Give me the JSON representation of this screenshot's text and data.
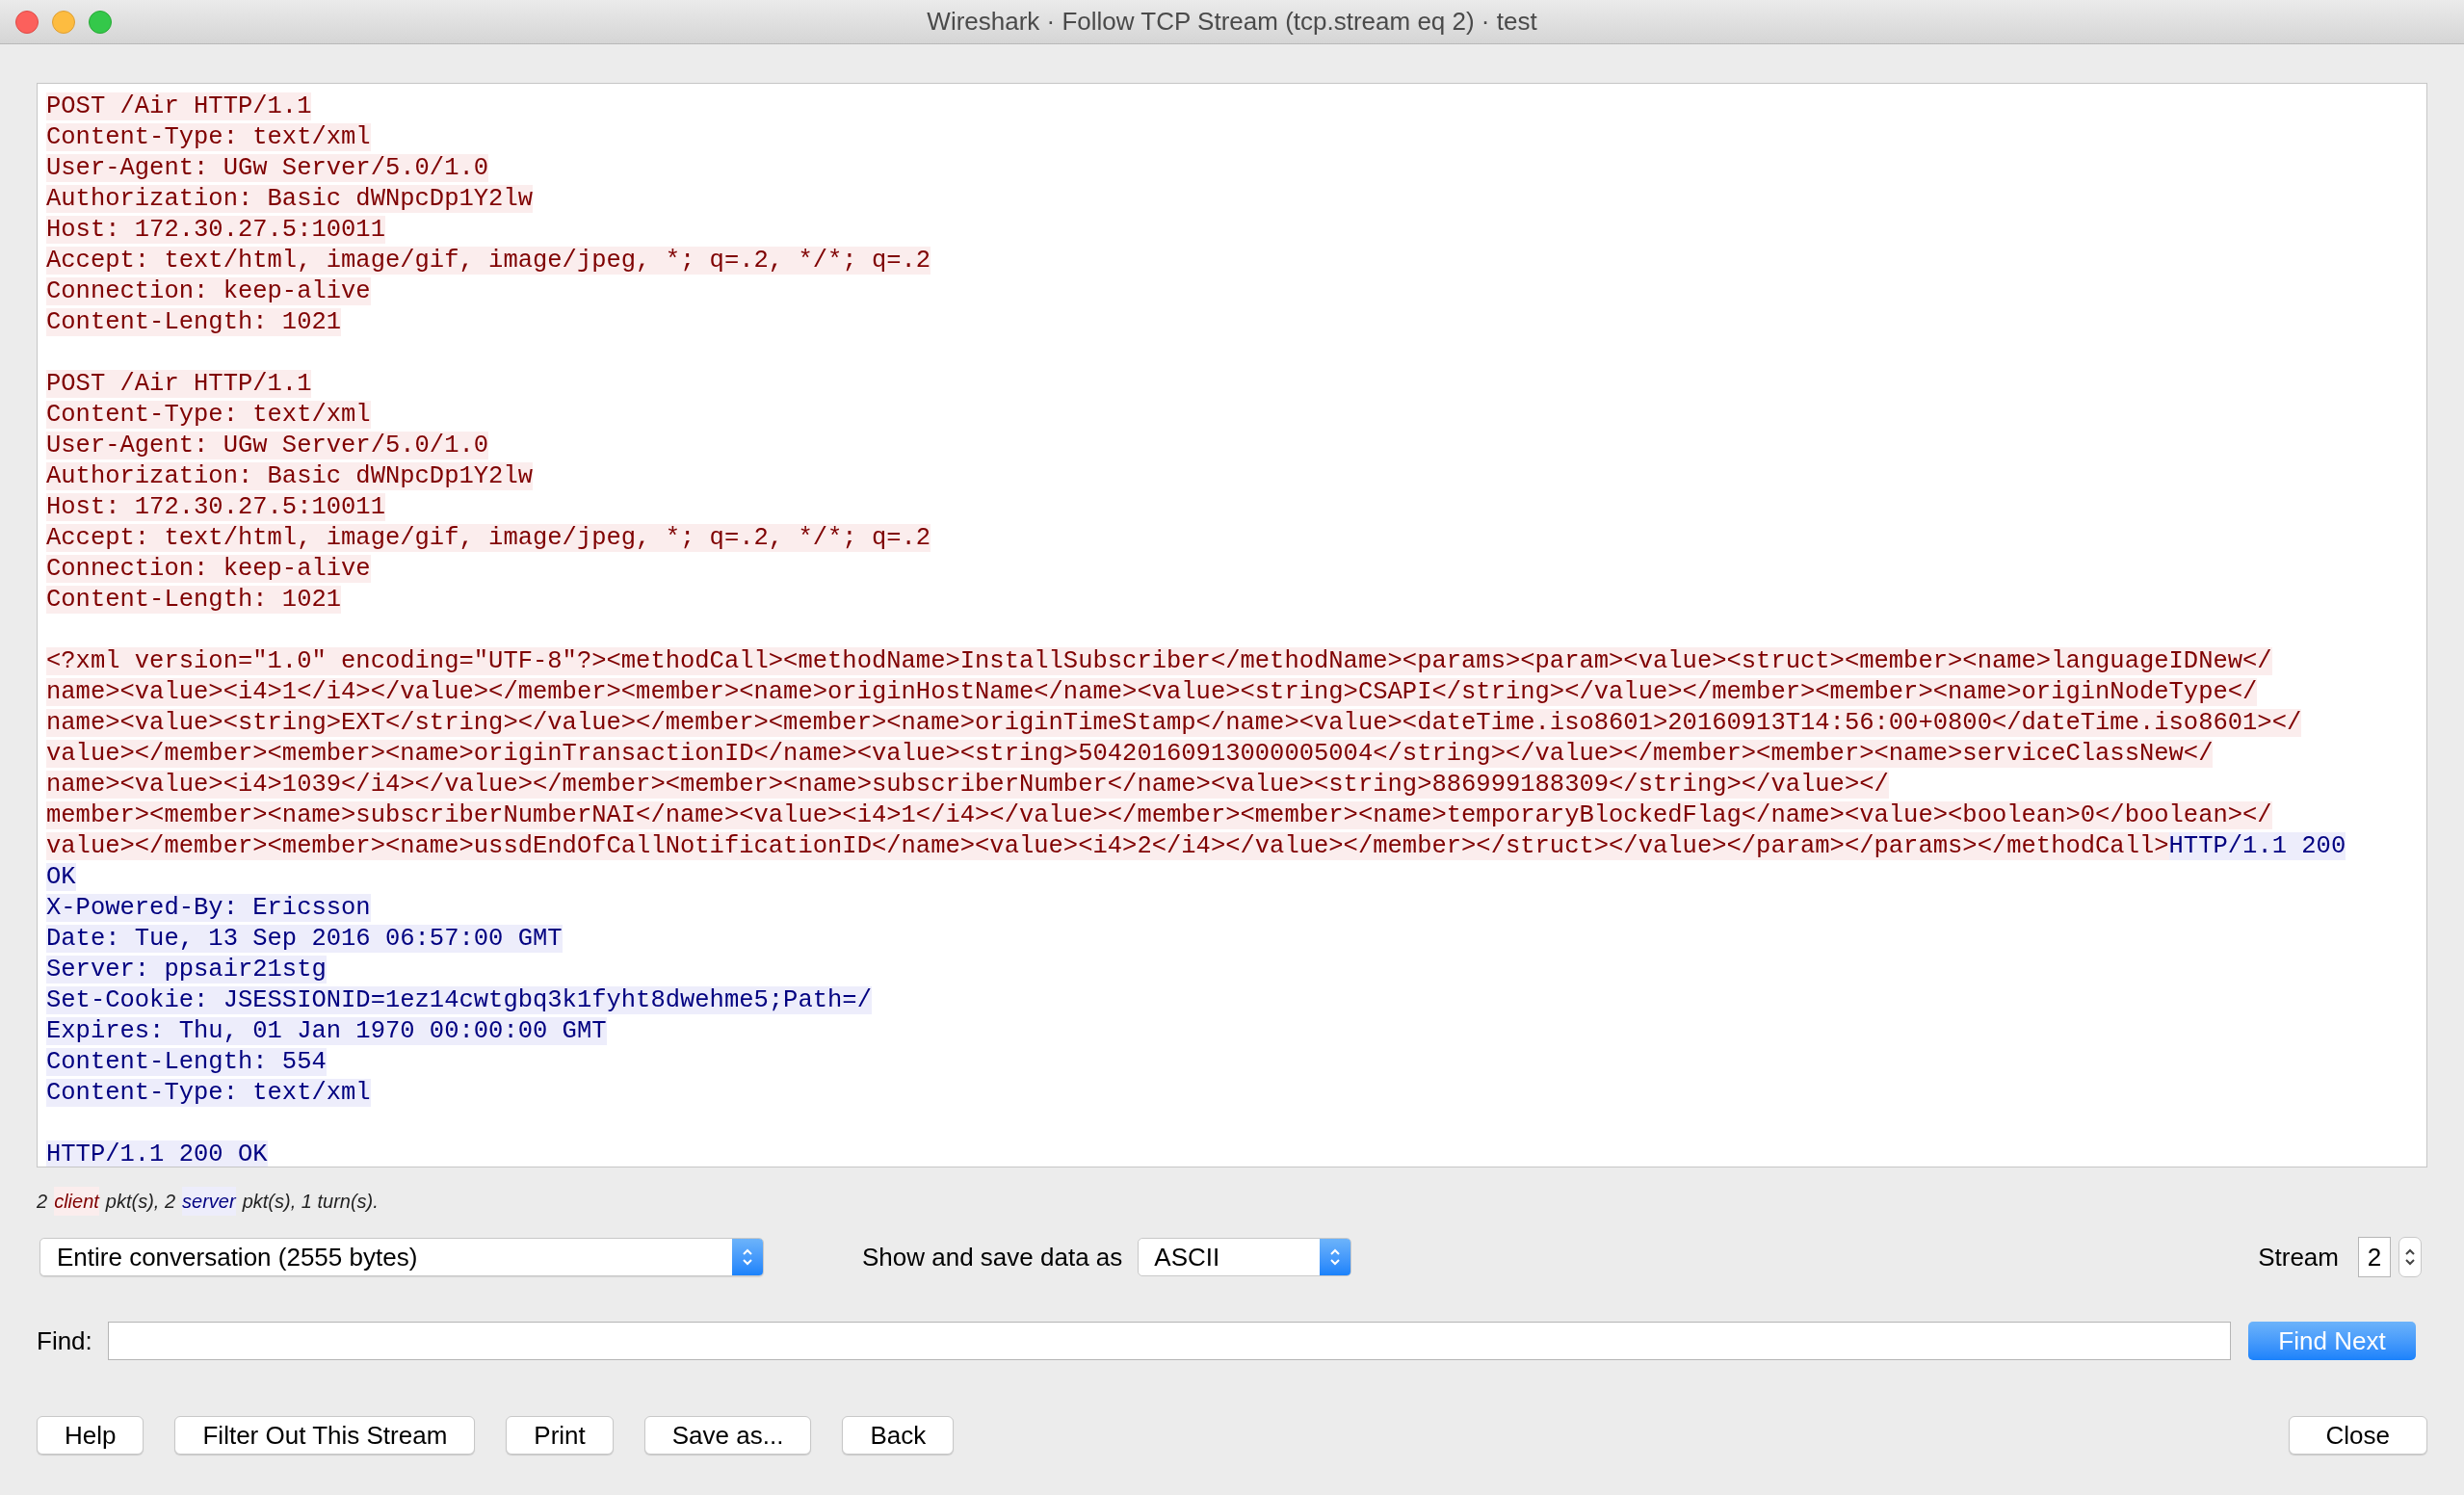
{
  "window": {
    "title": "Wireshark · Follow TCP Stream (tcp.stream eq 2) · test"
  },
  "stream": {
    "blocks": [
      {
        "lines": [
          [
            {
              "kind": "client",
              "text": "POST /Air HTTP/1.1"
            }
          ],
          [
            {
              "kind": "client",
              "text": "Content-Type: text/xml"
            }
          ],
          [
            {
              "kind": "client",
              "text": "User-Agent: UGw Server/5.0/1.0"
            }
          ],
          [
            {
              "kind": "client",
              "text": "Authorization: Basic dWNpcDp1Y2lw"
            }
          ],
          [
            {
              "kind": "client",
              "text": "Host: 172.30.27.5:10011"
            }
          ],
          [
            {
              "kind": "client",
              "text": "Accept: text/html, image/gif, image/jpeg, *; q=.2, */*; q=.2"
            }
          ],
          [
            {
              "kind": "client",
              "text": "Connection: keep-alive"
            }
          ],
          [
            {
              "kind": "client",
              "text": "Content-Length: 1021"
            }
          ]
        ]
      },
      {
        "lines": [
          [
            {
              "kind": "client",
              "text": "POST /Air HTTP/1.1"
            }
          ],
          [
            {
              "kind": "client",
              "text": "Content-Type: text/xml"
            }
          ],
          [
            {
              "kind": "client",
              "text": "User-Agent: UGw Server/5.0/1.0"
            }
          ],
          [
            {
              "kind": "client",
              "text": "Authorization: Basic dWNpcDp1Y2lw"
            }
          ],
          [
            {
              "kind": "client",
              "text": "Host: 172.30.27.5:10011"
            }
          ],
          [
            {
              "kind": "client",
              "text": "Accept: text/html, image/gif, image/jpeg, *; q=.2, */*; q=.2"
            }
          ],
          [
            {
              "kind": "client",
              "text": "Connection: keep-alive"
            }
          ],
          [
            {
              "kind": "client",
              "text": "Content-Length: 1021"
            }
          ]
        ]
      },
      {
        "lines": [
          [
            {
              "kind": "client",
              "text": "<?xml version=\"1.0\" encoding=\"UTF-8\"?><methodCall><methodName>InstallSubscriber</methodName><params><param><value><struct><member><name>languageIDNew</"
            }
          ],
          [
            {
              "kind": "client",
              "text": "name><value><i4>1</i4></value></member><member><name>originHostName</name><value><string>CSAPI</string></value></member><member><name>originNodeType</"
            }
          ],
          [
            {
              "kind": "client",
              "text": "name><value><string>EXT</string></value></member><member><name>originTimeStamp</name><value><dateTime.iso8601>20160913T14:56:00+0800</dateTime.iso8601></"
            }
          ],
          [
            {
              "kind": "client",
              "text": "value></member><member><name>originTransactionID</name><value><string>50420160913000005004</string></value></member><member><name>serviceClassNew</"
            }
          ],
          [
            {
              "kind": "client",
              "text": "name><value><i4>1039</i4></value></member><member><name>subscriberNumber</name><value><string>886999188309</string></value></"
            }
          ],
          [
            {
              "kind": "client",
              "text": "member><member><name>subscriberNumberNAI</name><value><i4>1</i4></value></member><member><name>temporaryBlockedFlag</name><value><boolean>0</boolean></"
            }
          ],
          [
            {
              "kind": "client",
              "text": "value></member><member><name>ussdEndOfCallNotificationID</name><value><i4>2</i4></value></member></struct></value></param></params></methodCall>"
            },
            {
              "kind": "server",
              "text": "HTTP/1.1 200"
            }
          ],
          [
            {
              "kind": "server",
              "text": "OK"
            }
          ],
          [
            {
              "kind": "server",
              "text": "X-Powered-By: Ericsson"
            }
          ],
          [
            {
              "kind": "server",
              "text": "Date: Tue, 13 Sep 2016 06:57:00 GMT"
            }
          ],
          [
            {
              "kind": "server",
              "text": "Server: ppsair21stg"
            }
          ],
          [
            {
              "kind": "server",
              "text": "Set-Cookie: JSESSIONID=1ez14cwtgbq3k1fyht8dwehme5;Path=/"
            }
          ],
          [
            {
              "kind": "server",
              "text": "Expires: Thu, 01 Jan 1970 00:00:00 GMT"
            }
          ],
          [
            {
              "kind": "server",
              "text": "Content-Length: 554"
            }
          ],
          [
            {
              "kind": "server",
              "text": "Content-Type: text/xml"
            }
          ]
        ]
      },
      {
        "lines": [
          [
            {
              "kind": "server",
              "text": "HTTP/1.1 200 OK"
            }
          ]
        ]
      }
    ]
  },
  "summary": [
    {
      "kind": "plain",
      "text": "2"
    },
    {
      "kind": "client",
      "text": "client"
    },
    {
      "kind": "plain",
      "text": "pkt(s), 2"
    },
    {
      "kind": "server",
      "text": "server"
    },
    {
      "kind": "plain",
      "text": "pkt(s), 1 turn(s)."
    }
  ],
  "conversation_select": {
    "value": "Entire conversation (2555 bytes)"
  },
  "format": {
    "label": "Show and save data as",
    "value": "ASCII"
  },
  "stream_spinner": {
    "label": "Stream",
    "value": "2"
  },
  "find": {
    "label": "Find:",
    "button": "Find Next"
  },
  "buttons": [
    "Help",
    "Filter Out This Stream",
    "Print",
    "Save as...",
    "Back"
  ],
  "close_button": "Close"
}
